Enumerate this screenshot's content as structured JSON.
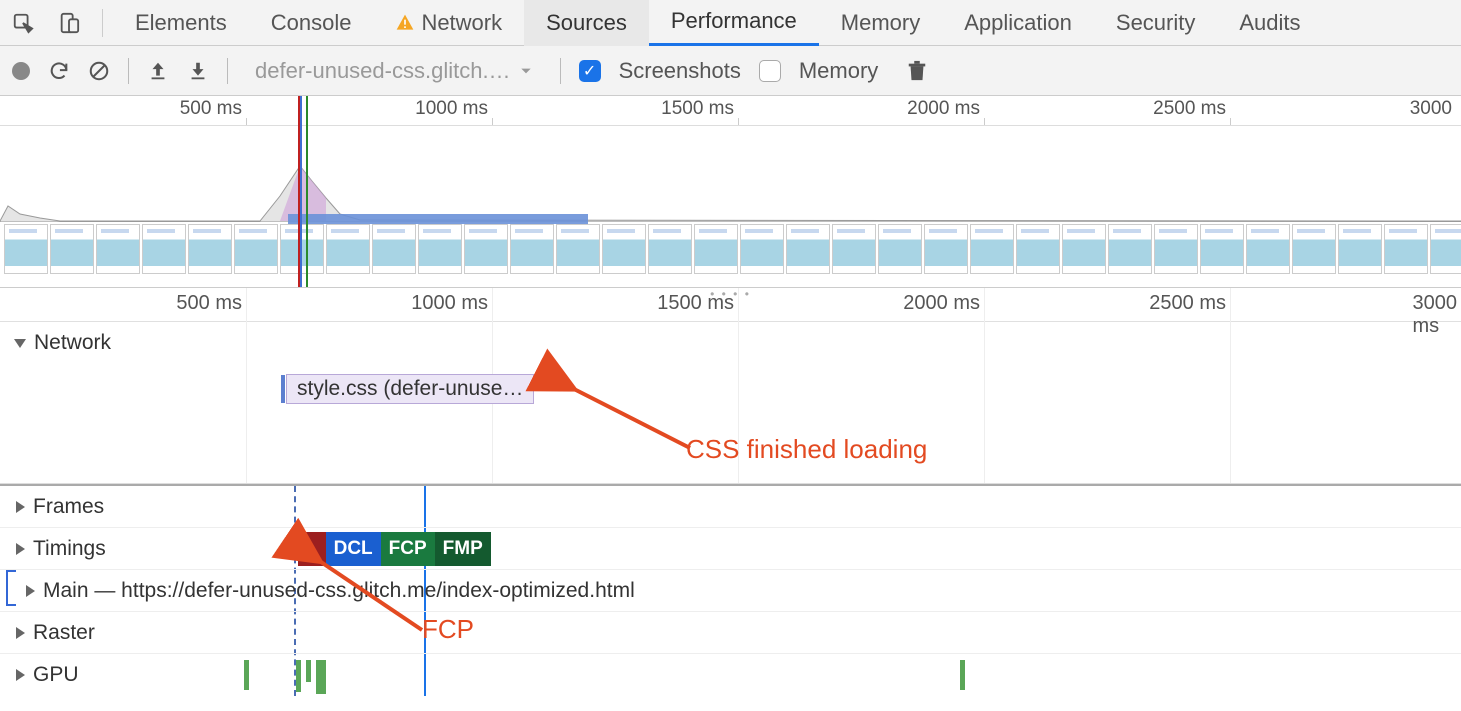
{
  "tabs": {
    "elements": "Elements",
    "console": "Console",
    "network": "Network",
    "sources": "Sources",
    "performance": "Performance",
    "memory": "Memory",
    "application": "Application",
    "security": "Security",
    "audits": "Audits"
  },
  "toolbar": {
    "dropdown": "defer-unused-css.glitch.…",
    "screenshots_label": "Screenshots",
    "memory_label": "Memory"
  },
  "overview": {
    "ticks": [
      "500 ms",
      "1000 ms",
      "1500 ms",
      "2000 ms",
      "2500 ms",
      "3000"
    ]
  },
  "middle": {
    "ticks": [
      "500 ms",
      "1000 ms",
      "1500 ms",
      "2000 ms",
      "2500 ms",
      "3000 ms"
    ],
    "network_label": "Network",
    "network_item": "style.css (defer-unuse…"
  },
  "lower": {
    "frames": "Frames",
    "timings": "Timings",
    "main": "Main — https://defer-unused-css.glitch.me/index-optimized.html",
    "raster": "Raster",
    "gpu": "GPU",
    "badges": {
      "l": "L",
      "dcl": "DCL",
      "fcp": "FCP",
      "fmp": "FMP"
    }
  },
  "annotations": {
    "css": "CSS finished loading",
    "fcp": "FCP"
  }
}
